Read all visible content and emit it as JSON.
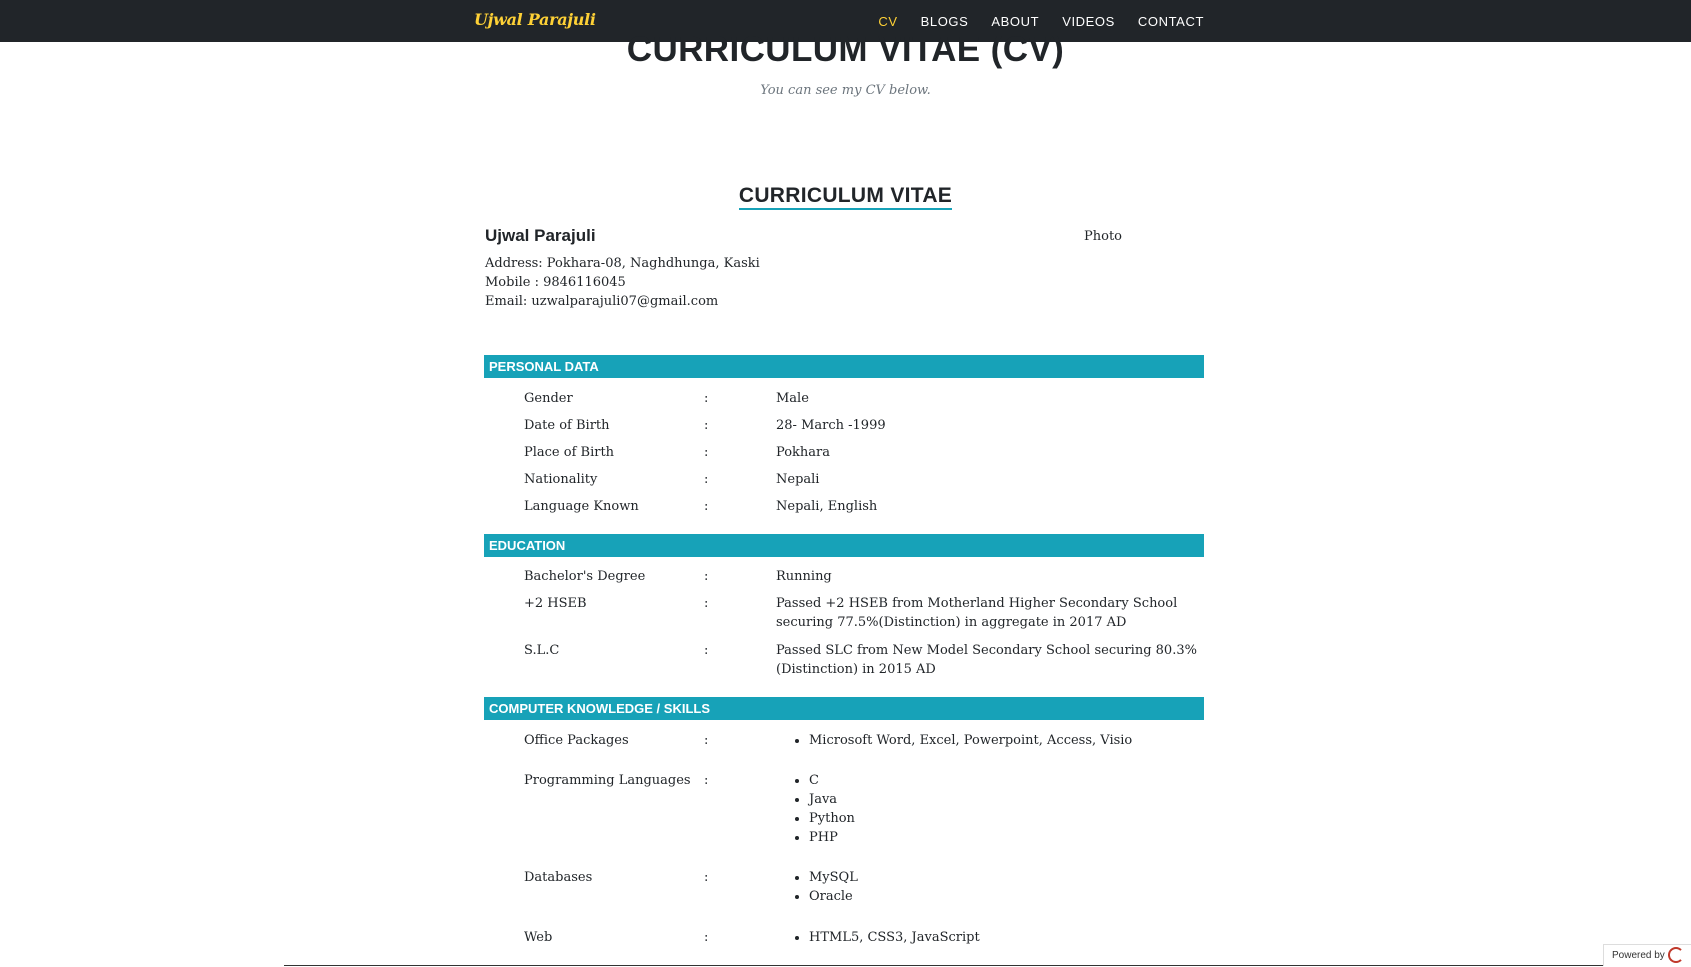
{
  "nav": {
    "brand": "Ujwal Parajuli",
    "links": [
      "CV",
      "BLOGS",
      "ABOUT",
      "VIDEOS",
      "CONTACT"
    ]
  },
  "header": {
    "heading": "CURRICULUM VITAE (CV)",
    "subheading": "You can see my CV below."
  },
  "cv": {
    "title": "CURRICULUM VITAE",
    "name": "Ujwal Parajuli",
    "photo_label": "Photo",
    "address": "Address: Pokhara-08, Naghdhunga, Kaski",
    "mobile": "Mobile : 9846116045",
    "email": "Email: uzwalparajuli07@gmail.com",
    "sections": {
      "personal": {
        "title": "PERSONAL DATA",
        "rows": [
          {
            "label": "Gender",
            "value": "Male"
          },
          {
            "label": "Date of Birth",
            "value": "28- March -1999"
          },
          {
            "label": "Place of Birth",
            "value": "Pokhara"
          },
          {
            "label": "Nationality",
            "value": "Nepali"
          },
          {
            "label": "Language Known",
            "value": "Nepali, English"
          }
        ]
      },
      "education": {
        "title": "EDUCATION",
        "rows": [
          {
            "label": "Bachelor's Degree",
            "value": "Running"
          },
          {
            "label": "+2 HSEB",
            "value": "Passed +2 HSEB from Motherland Higher Secondary School securing 77.5%(Distinction) in aggregate in 2017 AD"
          },
          {
            "label": "S.L.C",
            "value": "Passed SLC from New Model Secondary School securing 80.3%(Distinction) in 2015 AD"
          }
        ]
      },
      "skills": {
        "title": "COMPUTER KNOWLEDGE / SKILLS",
        "rows": [
          {
            "label": "Office Packages",
            "items": [
              "Microsoft Word, Excel, Powerpoint, Access, Visio"
            ]
          },
          {
            "label": "Programming Languages",
            "items": [
              "C",
              "Java",
              "Python",
              "PHP"
            ]
          },
          {
            "label": "Databases",
            "items": [
              "MySQL",
              "Oracle"
            ]
          },
          {
            "label": "Web",
            "items": [
              "HTML5, CSS3, JavaScript"
            ]
          }
        ]
      }
    },
    "colon": ":"
  },
  "footer": {
    "powered_by": "Powered by"
  }
}
